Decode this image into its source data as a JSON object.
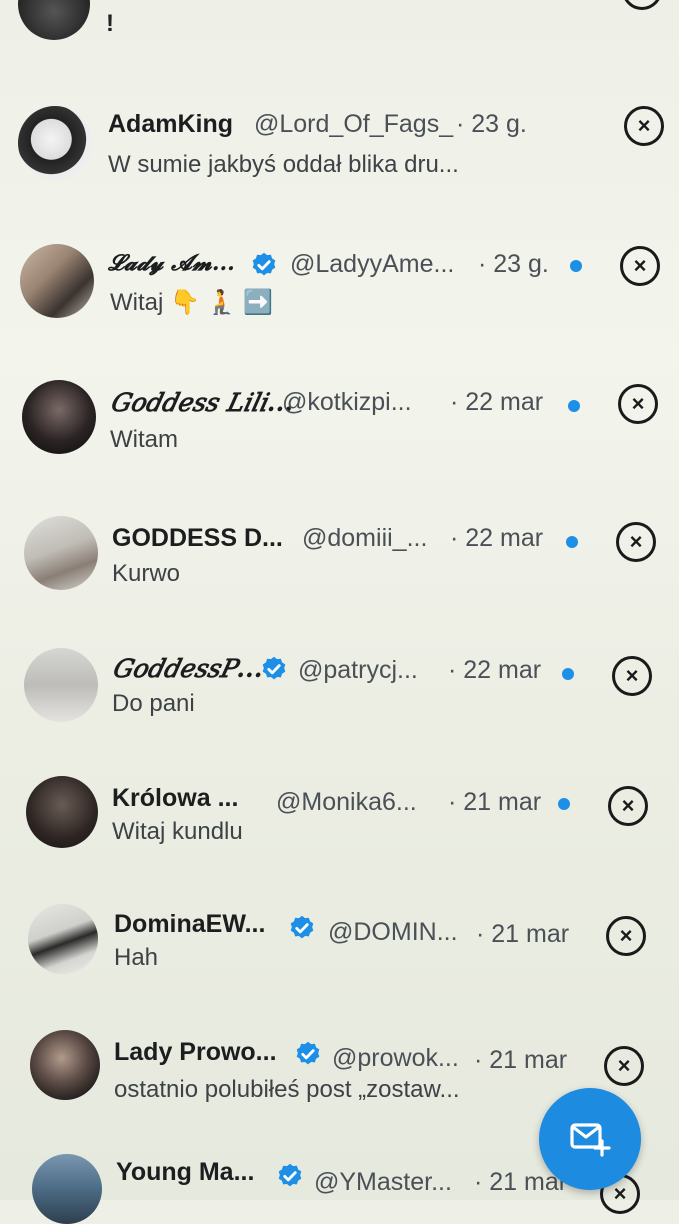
{
  "top_partial": {
    "msg": "!"
  },
  "messages": [
    {
      "name": "AdamKing",
      "handle": "@Lord_Of_Fags_",
      "time": "· 23 g.",
      "msg": "W sumie jakbyś oddał blika dru...",
      "verified": false,
      "unread": false
    },
    {
      "name": "𝓛𝓪𝓭𝔂 𝓐𝓶...",
      "handle": "@LadyyAme...",
      "time": "· 23 g.",
      "msg": "Witaj 👇 🧎 ➡️",
      "verified": true,
      "unread": true
    },
    {
      "name": "𝐺𝑜𝑑𝑑𝑒𝑠𝑠 𝐿𝑖𝑙𝑖...",
      "handle": "@kotkizpi...",
      "time": "· 22 mar",
      "msg": "Witam",
      "verified": false,
      "unread": true
    },
    {
      "name": "GODDESS D...",
      "handle": "@domiii_...",
      "time": "· 22 mar",
      "msg": "Kurwo",
      "verified": false,
      "unread": true
    },
    {
      "name": "𝐺𝑜𝑑𝑑𝑒𝑠𝑠𝑃...",
      "handle": "@patrycj...",
      "time": "· 22 mar",
      "msg": "Do pani",
      "verified": true,
      "unread": true
    },
    {
      "name": "Królowa ...",
      "handle": "@Monika6...",
      "time": "· 21 mar",
      "msg": "Witaj kundlu",
      "verified": false,
      "unread": true
    },
    {
      "name": "DominaEW...",
      "handle": "@DOMIN...",
      "time": "· 21 mar",
      "msg": "Hah",
      "verified": true,
      "unread": false
    },
    {
      "name": "Lady Prowo...",
      "handle": "@prowok...",
      "time": "· 21 mar",
      "msg": "ostatnio polubiłeś post „zostaw...",
      "verified": true,
      "unread": false
    },
    {
      "name": "Young Ma...",
      "handle": "@YMaster...",
      "time": "· 21 mar",
      "msg": "",
      "verified": true,
      "unread": false
    }
  ],
  "colors": {
    "accent": "#1d8be0",
    "verified": "#1d8fe6",
    "unread_dot": "#1d8fe6"
  },
  "icons": {
    "close": "close-circle-icon",
    "fab": "new-message-icon",
    "verified": "verified-badge-icon"
  }
}
